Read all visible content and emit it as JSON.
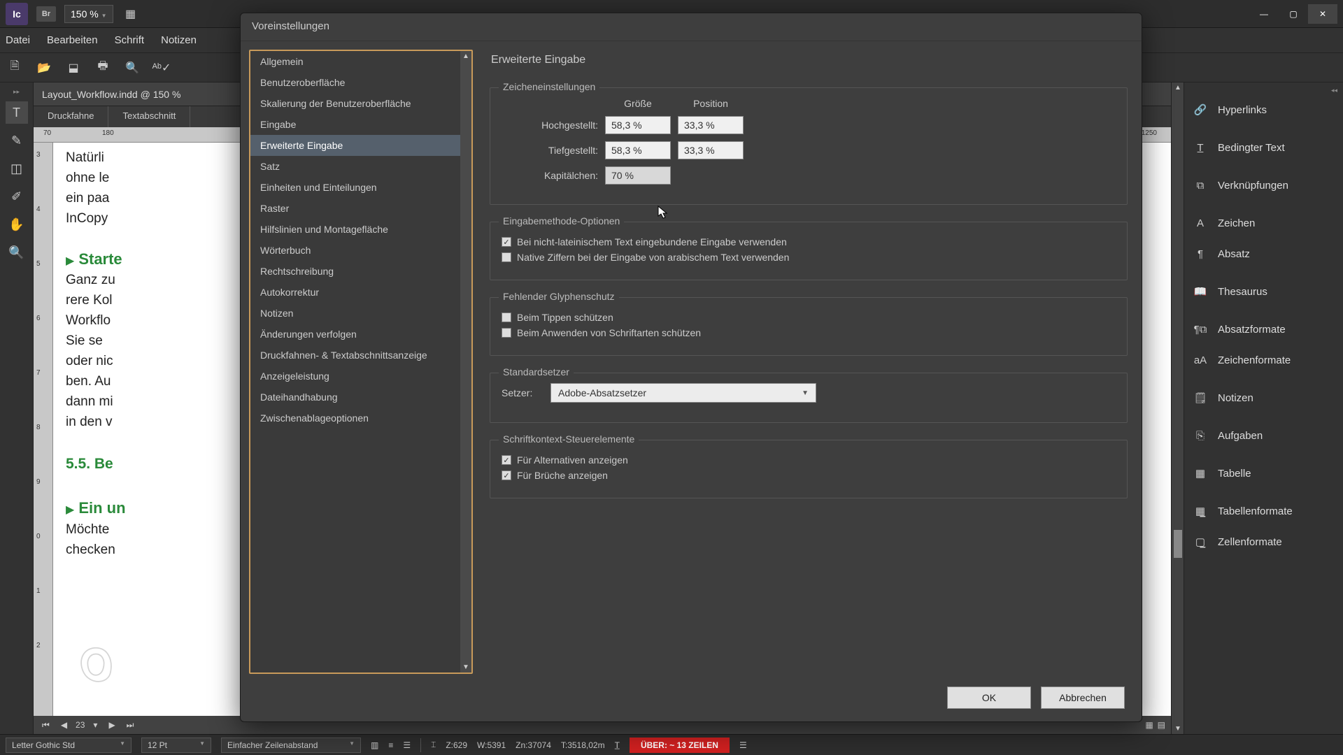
{
  "app": {
    "logo": "Ic",
    "bridge": "Br",
    "zoom": "150 %"
  },
  "menu": [
    "Datei",
    "Bearbeiten",
    "Schrift",
    "Notizen"
  ],
  "doc": {
    "tab": "Layout_Workflow.indd @ 150 %",
    "subtabs": [
      "Druckfahne",
      "Textabschnitt"
    ],
    "ruler_h": [
      "70",
      "180",
      "1250"
    ],
    "ruler_v": [
      "3",
      "4",
      "5",
      "6",
      "7",
      "8",
      "9",
      "0",
      "1",
      "2"
    ],
    "text": {
      "p1": "Natürli",
      "p2": "ohne le",
      "p3": "ein paa",
      "p4": "InCopy",
      "h1": "Starte",
      "p5": "Ganz zu",
      "p6": "rere Kol",
      "p7": "Workflo",
      "p8": "    Sie se",
      "p9": "oder nic",
      "p10": "ben. Au",
      "p11": "dann mi",
      "p12": "in den v",
      "h2": "5.5.  Be",
      "h3": "Ein un",
      "p13": "Möchte",
      "p14": "checken"
    },
    "pager": "23"
  },
  "panels": [
    "Hyperlinks",
    "Bedingter Text",
    "Verknüpfungen",
    "Zeichen",
    "Absatz",
    "Thesaurus",
    "Absatzformate",
    "Zeichenformate",
    "Notizen",
    "Aufgaben",
    "Tabelle",
    "Tabellenformate",
    "Zellenformate"
  ],
  "dialog": {
    "title": "Voreinstellungen",
    "categories": [
      "Allgemein",
      "Benutzeroberfläche",
      "Skalierung der Benutzeroberfläche",
      "Eingabe",
      "Erweiterte Eingabe",
      "Satz",
      "Einheiten und Einteilungen",
      "Raster",
      "Hilfslinien und Montagefläche",
      "Wörterbuch",
      "Rechtschreibung",
      "Autokorrektur",
      "Notizen",
      "Änderungen verfolgen",
      "Druckfahnen- & Textabschnittsanzeige",
      "Anzeigeleistung",
      "Dateihandhabung",
      "Zwischenablageoptionen"
    ],
    "selected_index": 4,
    "heading": "Erweiterte Eingabe",
    "char_group": {
      "title": "Zeicheneinstellungen",
      "col1": "Größe",
      "col2": "Position",
      "super_label": "Hochgestellt:",
      "super_size": "58,3 %",
      "super_pos": "33,3 %",
      "sub_label": "Tiefgestellt:",
      "sub_size": "58,3 %",
      "sub_pos": "33,3 %",
      "smallcap_label": "Kapitälchen:",
      "smallcap_val": "70 %"
    },
    "ime_group": {
      "title": "Eingabemethode-Optionen",
      "opt1": "Bei nicht-lateinischem Text eingebundene Eingabe verwenden",
      "opt2": "Native Ziffern bei der Eingabe von arabischem Text verwenden",
      "opt1_checked": true,
      "opt2_checked": false
    },
    "glyph_group": {
      "title": "Fehlender Glyphenschutz",
      "opt1": "Beim Tippen schützen",
      "opt2": "Beim Anwenden von Schriftarten schützen",
      "opt1_checked": false,
      "opt2_checked": false
    },
    "composer_group": {
      "title": "Standardsetzer",
      "label": "Setzer:",
      "value": "Adobe-Absatzsetzer"
    },
    "context_group": {
      "title": "Schriftkontext-Steuerelemente",
      "opt1": "Für Alternativen anzeigen",
      "opt2": "Für Brüche anzeigen",
      "opt1_checked": true,
      "opt2_checked": true
    },
    "ok": "OK",
    "cancel": "Abbrechen"
  },
  "status": {
    "font": "Letter Gothic Std",
    "size": "12 Pt",
    "leading": "Einfacher Zeilenabstand",
    "z": "Z:629",
    "w": "W:5391",
    "zn": "Zn:37074",
    "t": "T:3518,02m",
    "overset": "ÜBER:  ~ 13 ZEILEN"
  }
}
